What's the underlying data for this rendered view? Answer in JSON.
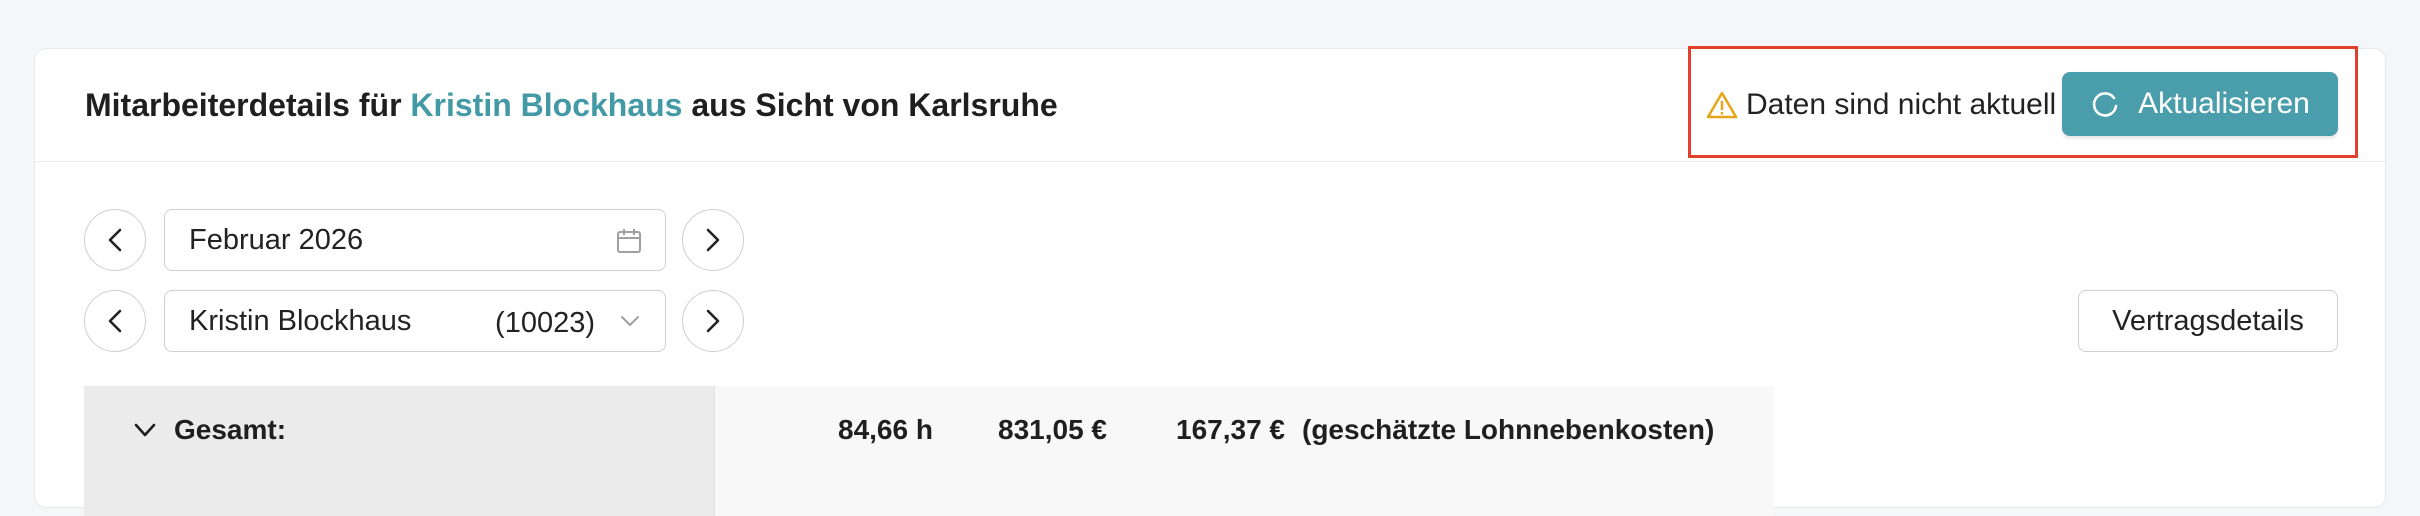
{
  "header": {
    "title_prefix": "Mitarbeiterdetails für",
    "employee_name": "Kristin Blockhaus",
    "title_suffix": "aus Sicht von Karlsruhe",
    "warning_text": "Daten sind nicht aktuell",
    "refresh_label": "Aktualisieren"
  },
  "filters": {
    "month_value": "Februar 2026",
    "employee_value": "Kristin Blockhaus",
    "employee_code": "(10023)"
  },
  "actions": {
    "contract_details_label": "Vertragsdetails"
  },
  "summary": {
    "label": "Gesamt:",
    "hours": "84,66 h",
    "amount": "831,05 €",
    "additional_costs": "167,37 €",
    "additional_costs_note": "(geschätzte Lohnnebenkosten)"
  },
  "colors": {
    "accent": "#4a9eab",
    "name_link": "#4499a6",
    "highlight_border": "#e2402c",
    "warning": "#e8a317"
  }
}
